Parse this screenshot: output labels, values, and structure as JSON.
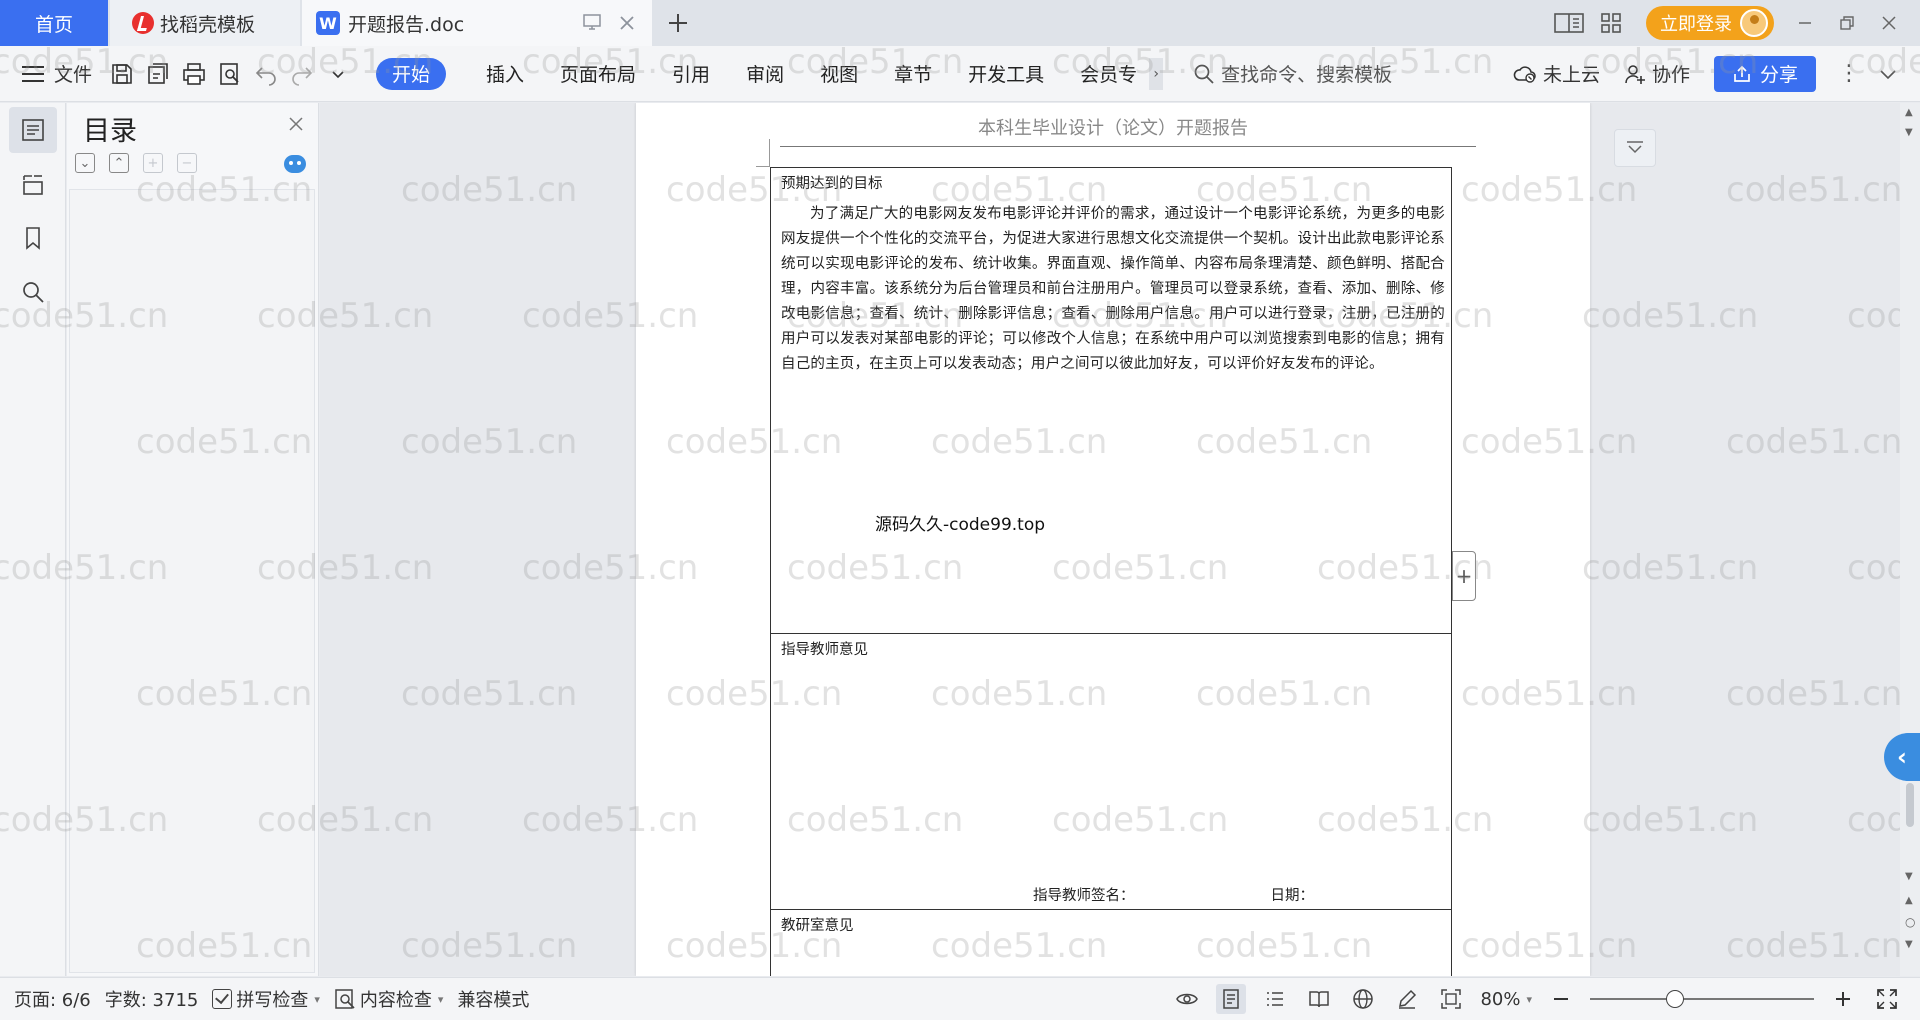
{
  "titlebar": {
    "tabs": [
      {
        "label": "首页"
      },
      {
        "label": "找稻壳模板"
      },
      {
        "label": "开题报告.doc"
      }
    ],
    "login_label": "立即登录"
  },
  "menubar": {
    "file_label": "文件",
    "tabs": [
      "开始",
      "插入",
      "页面布局",
      "引用",
      "审阅",
      "视图",
      "章节",
      "开发工具",
      "会员专"
    ],
    "search_placeholder": "查找命令、搜索模板",
    "cloud_label": "未上云",
    "collab_label": "协作",
    "share_label": "分享"
  },
  "toc": {
    "title": "目录"
  },
  "document": {
    "header": "本科生毕业设计（论文）开题报告",
    "goal": {
      "label": "预期达到的目标",
      "text": "为了满足广大的电影网友发布电影评论并评价的需求，通过设计一个电影评论系统，为更多的电影网友提供一个个性化的交流平台，为促进大家进行思想文化交流提供一个契机。设计出此款电影评论系统可以实现电影评论的发布、统计收集。界面直观、操作简单、内容布局条理清楚、颜色鲜明、搭配合理，内容丰富。该系统分为后台管理员和前台注册用户。管理员可以登录系统，查看、添加、删除、修改电影信息；查看、统计、删除影评信息；查看、删除用户信息。用户可以进行登录，注册，已注册的用户可以发表对某部电影的评论；可以修改个人信息；在系统中用户可以浏览搜索到电影的信息；拥有自己的主页，在主页上可以发表动态；用户之间可以彼此加好友，可以评价好友发布的评论。",
      "stamp": "源码久久-code99.top"
    },
    "advisor": {
      "label": "指导教师意见",
      "sign_label": "指导教师签名：",
      "date_label": "日期："
    },
    "office": {
      "label": "教研室意见"
    }
  },
  "watermark": "code51.cn",
  "statusbar": {
    "page": "页面: 6/6",
    "words": "字数: 3715",
    "spell": "拼写检查",
    "content_check": "内容检查",
    "compat": "兼容模式",
    "zoom": "80%",
    "zoom_fraction": 0.38
  }
}
